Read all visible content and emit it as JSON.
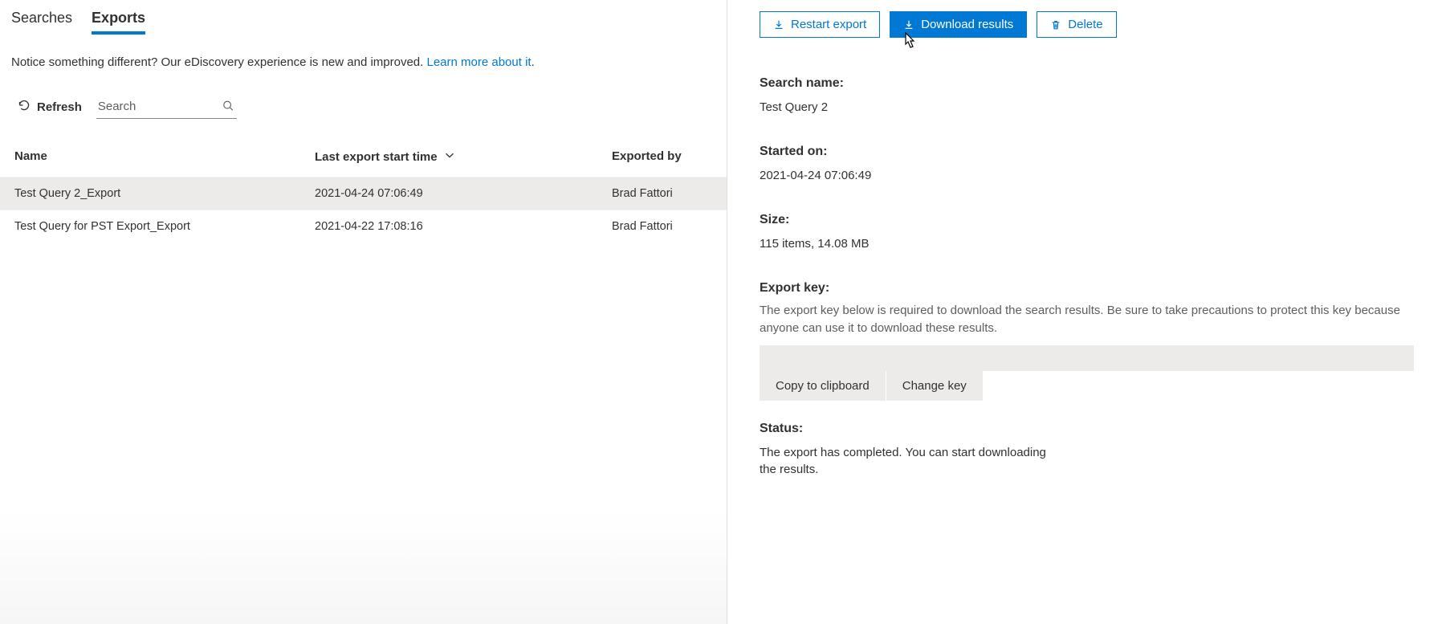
{
  "tabs": {
    "searches": "Searches",
    "exports": "Exports"
  },
  "notice": {
    "text": "Notice something different? Our eDiscovery experience is new and improved. ",
    "link": "Learn more about it",
    "suffix": "."
  },
  "toolbar": {
    "refresh": "Refresh",
    "search_placeholder": "Search"
  },
  "table": {
    "headers": {
      "name": "Name",
      "time": "Last export start time",
      "by": "Exported by"
    },
    "rows": [
      {
        "name": "Test Query 2_Export",
        "time": "2021-04-24 07:06:49",
        "by": "Brad Fattori",
        "selected": true
      },
      {
        "name": "Test Query for PST Export_Export",
        "time": "2021-04-22 17:08:16",
        "by": "Brad Fattori",
        "selected": false
      }
    ]
  },
  "actions": {
    "restart": "Restart export",
    "download": "Download results",
    "delete": "Delete"
  },
  "details": {
    "search_name_label": "Search name:",
    "search_name_value": "Test Query 2",
    "started_label": "Started on:",
    "started_value": "2021-04-24 07:06:49",
    "size_label": "Size:",
    "size_value": "115 items, 14.08 MB",
    "export_key_label": "Export key:",
    "export_key_help": "The export key below is required to download the search results. Be sure to take precautions to protect this key because anyone can use it to download these results.",
    "copy_btn": "Copy to clipboard",
    "change_btn": "Change key",
    "status_label": "Status:",
    "status_value": "The export has completed. You can start downloading the results."
  }
}
